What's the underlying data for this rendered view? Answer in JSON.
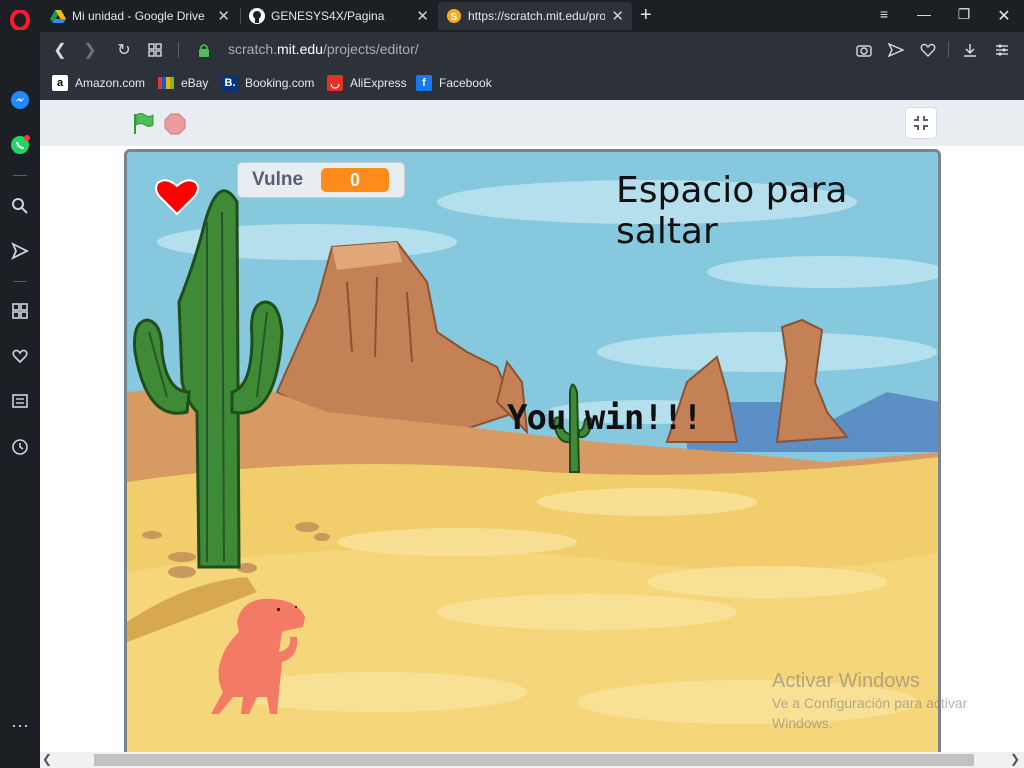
{
  "browser": {
    "tabs": [
      {
        "title": "Mi unidad - Google Drive"
      },
      {
        "title": "GENESYS4X/Pagina"
      },
      {
        "title": "https://scratch.mit.edu/proj"
      }
    ],
    "url_prefix": "scratch.",
    "url_domain": "mit.edu",
    "url_path": "/projects/editor/",
    "bookmarks": [
      {
        "label": "Amazon.com",
        "color": "#ffffff"
      },
      {
        "label": "eBay",
        "color": "#e53238"
      },
      {
        "label": "Booking.com",
        "color": "#003580"
      },
      {
        "label": "AliExpress",
        "color": "#e43225"
      },
      {
        "label": "Facebook",
        "color": "#1877f2"
      }
    ]
  },
  "scratch": {
    "variable": {
      "name": "Vulne",
      "value": "0"
    },
    "stage_title": "Espacio para saltar",
    "win_message": "You win!!!",
    "colors": {
      "accent": "#ff8c1a",
      "flag": "#4cbf56",
      "stop": "#ec9c9c"
    }
  },
  "watermark": {
    "title": "Activar Windows",
    "subtitle": "Ve a Configuración para activar Windows."
  }
}
